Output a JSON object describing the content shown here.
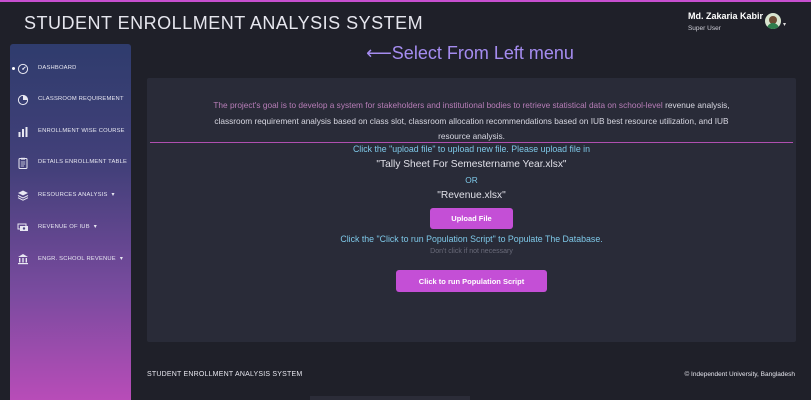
{
  "app": {
    "title": "STUDENT ENROLLMENT ANALYSIS SYSTEM"
  },
  "user": {
    "name": "Md. Zakaria Kabir",
    "role": "Super User",
    "caret": "▾"
  },
  "sidebar": {
    "items": [
      {
        "label": "DASHBOARD",
        "icon": "dashboard-icon",
        "active": true
      },
      {
        "label": "CLASSROOM REQUIREMENT",
        "icon": "pie-chart-icon"
      },
      {
        "label": "ENROLLMENT WISE COURSE",
        "icon": "bar-chart-icon"
      },
      {
        "label": "DETAILS ENROLLMENT TABLE",
        "icon": "clipboard-icon"
      },
      {
        "label": "RESOURCES ANALYSIS",
        "icon": "layers-icon",
        "caret": "▾"
      },
      {
        "label": "REVENUE OF IUB",
        "icon": "money-icon",
        "caret": "▾"
      },
      {
        "label": "ENGR. SCHOOL REVENUE",
        "icon": "bank-icon",
        "caret": "▾"
      }
    ]
  },
  "main": {
    "heading": "⟵Select From Left menu",
    "goal_lead": "The project's goal is to develop a system for stakeholders and institutional bodies to retrieve statistical data on school-level",
    "goal_rest": "revenue analysis, classroom requirement analysis based on class slot, classroom allocation recommendations based on IUB best resource utilization, and IUB resource analysis.",
    "upload_instruction": "Click the \"upload file\" to upload new file. Please upload file in",
    "file1": "\"Tally Sheet For Semestername Year.xlsx\"",
    "or": "OR",
    "file2": "\"Revenue.xlsx\"",
    "upload_button": "Upload File",
    "script_instruction": "Click the \"Click to run Population Script\" to Populate The Database.",
    "hint": "Don't click if not necessary",
    "script_button": "Click to run Population Script"
  },
  "footer": {
    "left": "STUDENT ENROLLMENT ANALYSIS SYSTEM",
    "right": "© Independent University, Bangladesh"
  },
  "colors": {
    "accent": "#c44fd6",
    "heading": "#a58cf0",
    "info_text": "#7ec8e8"
  }
}
